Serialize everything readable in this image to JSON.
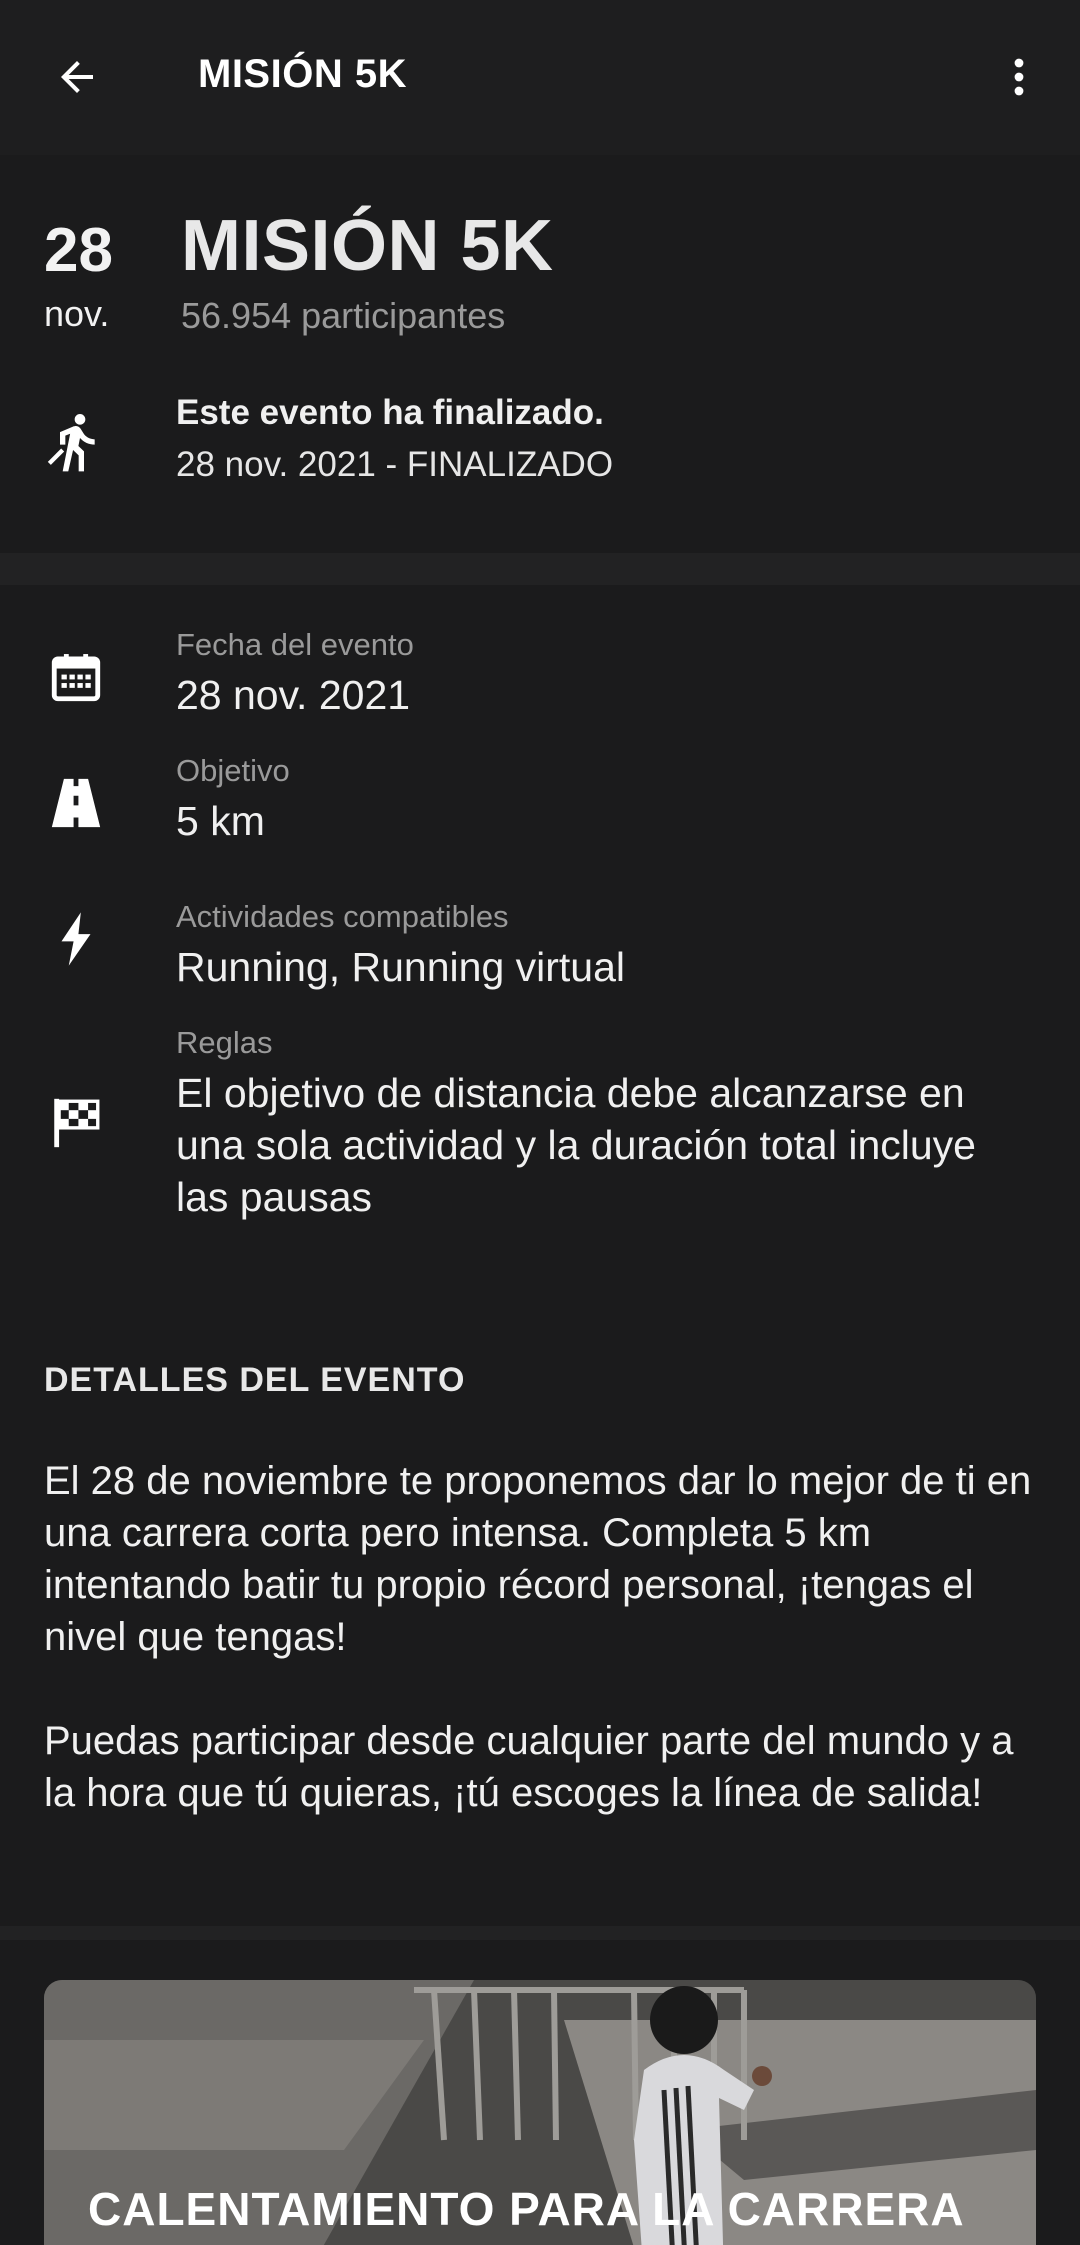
{
  "appbar": {
    "title": "MISIÓN 5K"
  },
  "event": {
    "day": "28",
    "month": "nov.",
    "title": "MISIÓN 5K",
    "participants": "56.954 participantes",
    "status_title": "Este evento ha finalizado.",
    "status_sub": "28 nov. 2021 - FINALIZADO"
  },
  "info": {
    "rows": [
      {
        "label": "Fecha del evento",
        "value": "28 nov. 2021",
        "icon": "calendar-icon"
      },
      {
        "label": "Objetivo",
        "value": "5 km",
        "icon": "road-icon"
      },
      {
        "label": "Actividades compatibles",
        "value": "Running, Running virtual",
        "icon": "lightning-icon"
      },
      {
        "label": "Reglas",
        "value": "El objetivo de distancia debe alcanzarse en una sola actividad y la duración total incluye las pausas",
        "icon": "checkered-flag-icon"
      }
    ]
  },
  "details": {
    "heading": "DETALLES DEL EVENTO",
    "paragraph1": "El 28 de noviembre te proponemos dar lo mejor de ti en una carrera corta pero intensa. Completa 5 km intentando batir tu propio récord personal, ¡tengas el nivel que tengas!",
    "paragraph2": "Puedas participar desde cualquier parte del mundo y a la hora que tú quieras, ¡tú escoges la línea de salida!"
  },
  "card": {
    "title": "CALENTAMIENTO PARA LA CARRERA"
  },
  "colors": {
    "background": "#1b1b1c",
    "appbar": "#1e1e1f",
    "secondary_text": "#9a9a9a"
  }
}
